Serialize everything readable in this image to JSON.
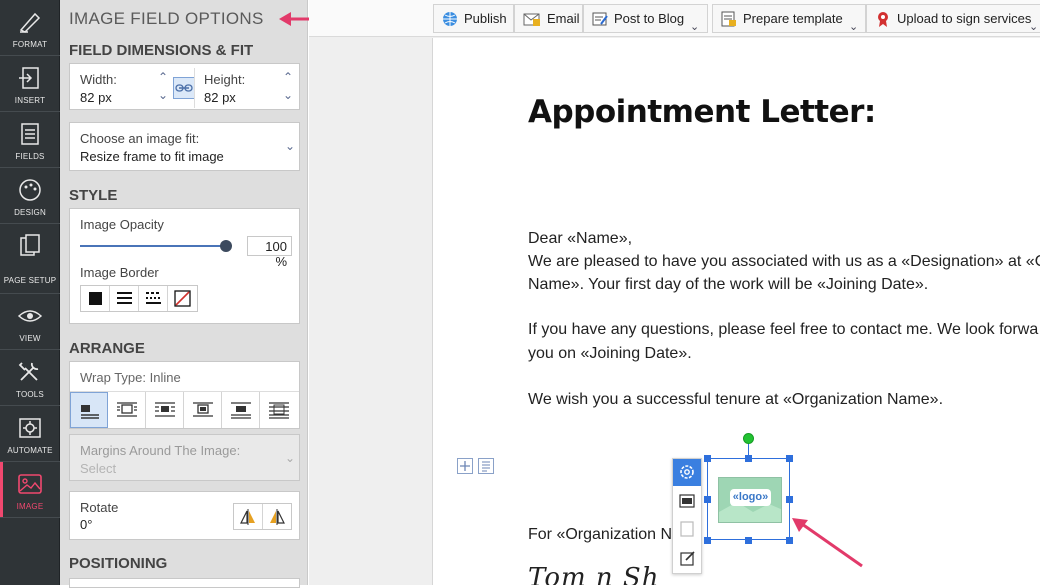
{
  "rail": {
    "items": [
      {
        "label": "FORMAT",
        "icon": "format-icon"
      },
      {
        "label": "INSERT",
        "icon": "insert-icon"
      },
      {
        "label": "FIELDS",
        "icon": "fields-icon"
      },
      {
        "label": "DESIGN",
        "icon": "design-icon"
      },
      {
        "label": "PAGE SETUP",
        "icon": "page-setup-icon"
      },
      {
        "label": "VIEW",
        "icon": "view-icon"
      },
      {
        "label": "TOOLS",
        "icon": "tools-icon"
      },
      {
        "label": "AUTOMATE",
        "icon": "automate-icon"
      },
      {
        "label": "IMAGE",
        "icon": "image-icon",
        "active": true
      }
    ]
  },
  "panel": {
    "title": "IMAGE FIELD OPTIONS",
    "dimensions": {
      "heading": "FIELD DIMENSIONS & FIT",
      "width_label": "Width:",
      "width_value": "82 px",
      "height_label": "Height:",
      "height_value": "82 px",
      "fit_label": "Choose an image fit:",
      "fit_value": "Resize frame to fit image"
    },
    "style": {
      "heading": "STYLE",
      "opacity_label": "Image Opacity",
      "opacity_value": "100 %",
      "opacity_level": 1.0,
      "border_label": "Image Border"
    },
    "arrange": {
      "heading": "ARRANGE",
      "wrap_label": "Wrap Type: Inline",
      "margins_label": "Margins Around The Image:",
      "margins_placeholder": "Select",
      "rotate_label": "Rotate",
      "rotate_value": "0°"
    },
    "positioning": {
      "heading": "POSITIONING"
    }
  },
  "toolbar": {
    "publish": "Publish",
    "email": "Email",
    "post_to_blog": "Post to Blog",
    "prepare_template": "Prepare template",
    "upload_to_sign": "Upload to sign services"
  },
  "document": {
    "title": "Appointment Letter:",
    "greeting": "Dear  «Name»,",
    "line1": "We are pleased to have you associated with us as a «Designation» at «O",
    "line2": "Name». Your first day of the work will be «Joining Date».",
    "line3": "If you have any questions, please feel free to contact me. We look forwa",
    "line4": "you on «Joining Date».",
    "line5": "We wish you a successful tenure at «Organization Name».",
    "closing": "For «Organization Na",
    "logo_placeholder": "«logo»"
  },
  "colors": {
    "accent": "#f0486f",
    "selection": "#2e6fdc",
    "rail_bg": "#2f3437",
    "panel_bg": "#dedede"
  }
}
